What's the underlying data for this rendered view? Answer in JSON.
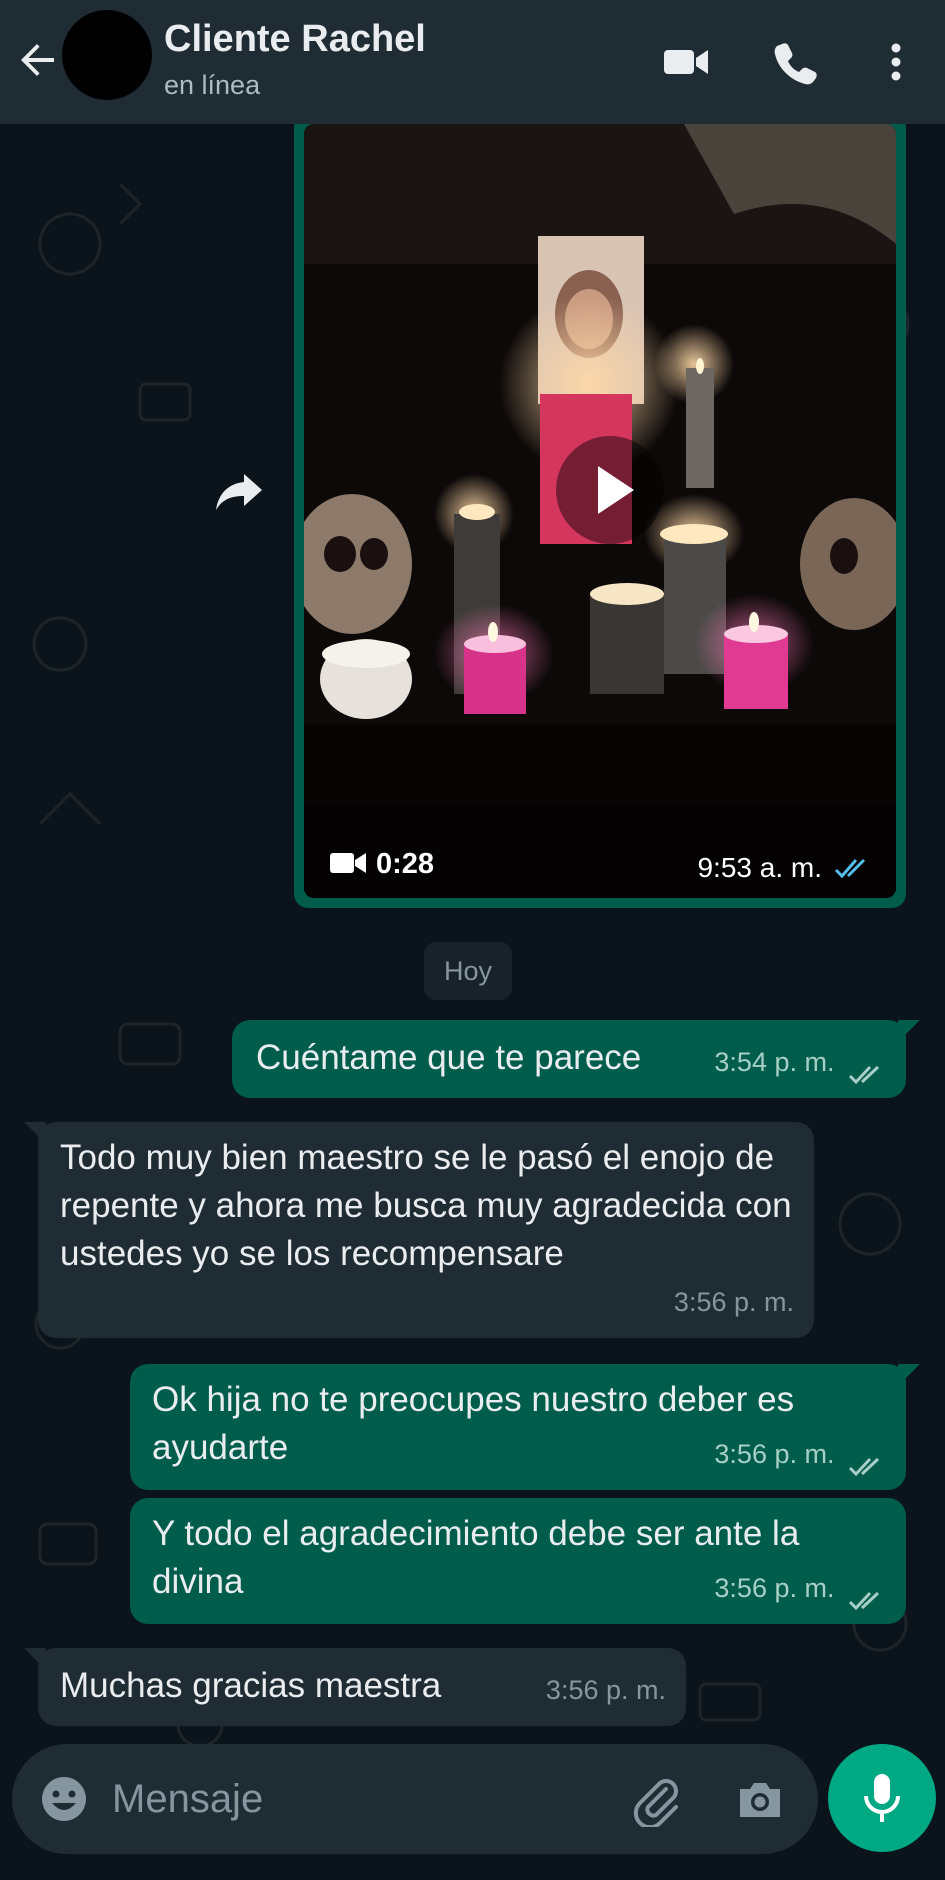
{
  "header": {
    "contact_name": "Cliente Rachel",
    "status": "en línea",
    "icons": [
      "back-arrow-icon",
      "video-call-icon",
      "phone-icon",
      "more-vert-icon"
    ]
  },
  "colors": {
    "header_bg": "#1f2c34",
    "chat_bg": "#0b141a",
    "outgoing_bubble": "#005c4b",
    "incoming_bubble": "#1f2c34",
    "accent": "#00a884",
    "read_ticks": "#53bdeb"
  },
  "video_message": {
    "duration": "0:28",
    "time": "9:53 a. m.",
    "status": "read"
  },
  "date_divider": "Hoy",
  "messages": [
    {
      "direction": "out",
      "text": "Cuéntame que te parece",
      "time": "3:54 p. m.",
      "status": "delivered"
    },
    {
      "direction": "in",
      "text": "Todo muy bien maestro se le pasó el enojo de repente y ahora me busca muy agradecida con ustedes yo se los recompensare",
      "time": "3:56 p. m."
    },
    {
      "direction": "out",
      "text": "Ok hija no te preocupes nuestro deber es ayudarte",
      "time": "3:56 p. m.",
      "status": "delivered"
    },
    {
      "direction": "out",
      "text": "Y todo el agradecimiento debe ser ante la divina",
      "time": "3:56 p. m.",
      "status": "delivered"
    },
    {
      "direction": "in",
      "text": "Muchas gracias maestra",
      "time": "3:56 p. m."
    }
  ],
  "input": {
    "placeholder": "Mensaje",
    "value": ""
  }
}
